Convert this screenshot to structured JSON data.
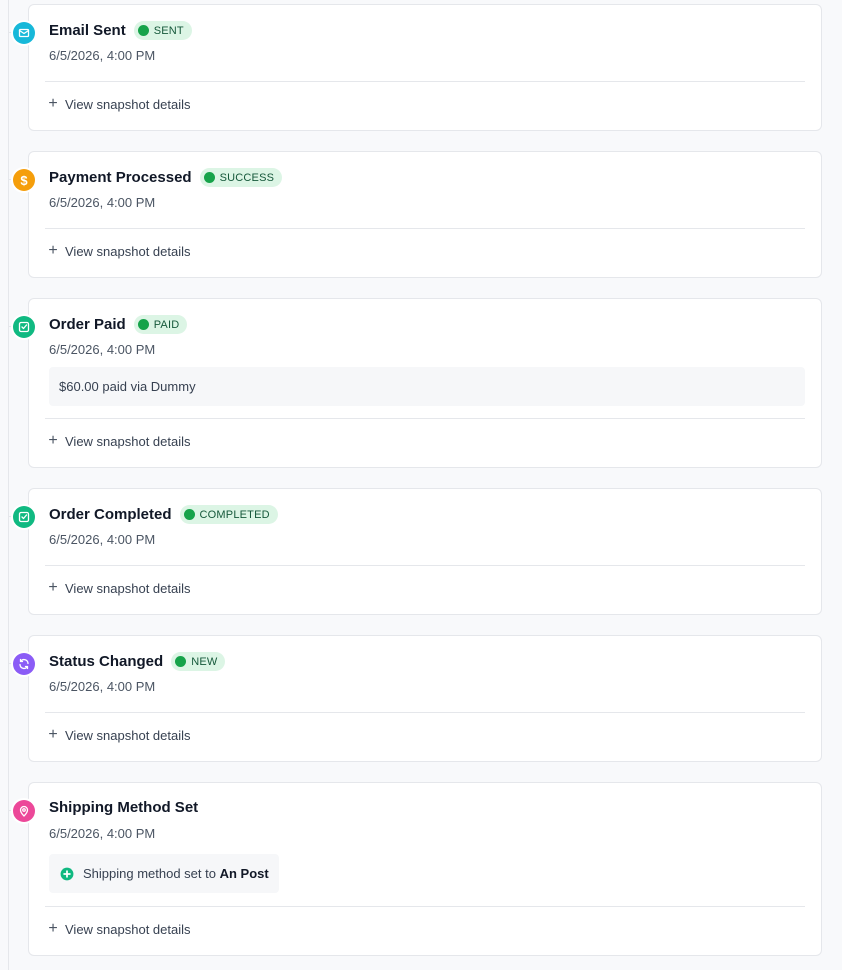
{
  "events": [
    {
      "title": "Email Sent",
      "status": "SENT",
      "timestamp": "6/5/2026, 4:00 PM",
      "icon": "mail-icon",
      "icon_color": "#17b8d9",
      "snapshot_label": "View snapshot details"
    },
    {
      "title": "Payment Processed",
      "status": "SUCCESS",
      "timestamp": "6/5/2026, 4:00 PM",
      "icon": "dollar-icon",
      "icon_color": "#f59e0b",
      "snapshot_label": "View snapshot details"
    },
    {
      "title": "Order Paid",
      "status": "PAID",
      "timestamp": "6/5/2026, 4:00 PM",
      "icon": "checkbox-icon",
      "icon_color": "#10b981",
      "note": "$60.00 paid via Dummy",
      "snapshot_label": "View snapshot details"
    },
    {
      "title": "Order Completed",
      "status": "COMPLETED",
      "timestamp": "6/5/2026, 4:00 PM",
      "icon": "checkbox-icon",
      "icon_color": "#10b981",
      "snapshot_label": "View snapshot details"
    },
    {
      "title": "Status Changed",
      "status": "NEW",
      "timestamp": "6/5/2026, 4:00 PM",
      "icon": "refresh-icon",
      "icon_color": "#8b5cf6",
      "snapshot_label": "View snapshot details"
    },
    {
      "title": "Shipping Method Set",
      "timestamp": "6/5/2026, 4:00 PM",
      "icon": "location-pin-icon",
      "icon_color": "#ec4899",
      "note_prefix": "Shipping method set to",
      "note_value": "An Post",
      "note_icon": "plus-circle-icon",
      "snapshot_label": "View snapshot details"
    }
  ],
  "badge_color": "#dcf5e5",
  "badge_dot_color": "#16a34a"
}
